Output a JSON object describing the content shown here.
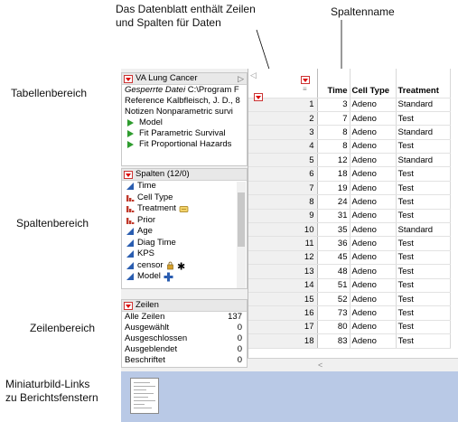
{
  "callouts": {
    "table_area": "Tabellenbereich",
    "column_area": "Spaltenbereich",
    "row_area": "Zeilenbereich",
    "thumbnail_line1": "Miniaturbild-Links",
    "thumbnail_line2": "zu Berichtsfenstern",
    "top_left_line1": "Das Datenblatt enthält Zeilen",
    "top_left_line2": "und Spalten für Daten",
    "column_name": "Spaltenname"
  },
  "table_panel": {
    "title": "VA Lung Cancer",
    "locked_file_label": "Gesperrte Datei",
    "locked_file_value": "C:\\Program F",
    "reference_label": "Reference",
    "reference_value": "Kalbfleisch, J. D., 8",
    "notes_label": "Notizen",
    "notes_value": "Nonparametric survi",
    "scripts": [
      "Model",
      "Fit Parametric Survival",
      "Fit Proportional Hazards"
    ]
  },
  "columns_panel": {
    "title": "Spalten (12/0)",
    "items": [
      {
        "name": "Time",
        "icon": "continuous-icon"
      },
      {
        "name": "Cell Type",
        "icon": "nominal-icon"
      },
      {
        "name": "Treatment",
        "icon": "nominal-icon",
        "extra": "value-labels-icon"
      },
      {
        "name": "Prior",
        "icon": "nominal-icon"
      },
      {
        "name": "Age",
        "icon": "continuous-icon"
      },
      {
        "name": "Diag Time",
        "icon": "continuous-icon"
      },
      {
        "name": "KPS",
        "icon": "continuous-icon"
      },
      {
        "name": "censor",
        "icon": "continuous-icon",
        "extra": "lock-and-asterisk-icon"
      },
      {
        "name": "Model",
        "icon": "continuous-icon",
        "extra": "formula-plus-icon"
      }
    ]
  },
  "rows_panel": {
    "title": "Zeilen",
    "items": [
      {
        "label": "Alle Zeilen",
        "value": "137"
      },
      {
        "label": "Ausgewählt",
        "value": "0"
      },
      {
        "label": "Ausgeschlossen",
        "value": "0"
      },
      {
        "label": "Ausgeblendet",
        "value": "0"
      },
      {
        "label": "Beschriftet",
        "value": "0"
      }
    ]
  },
  "grid": {
    "headers": [
      "Time",
      "Cell Type",
      "Treatment"
    ],
    "rows": [
      [
        "1",
        "3",
        "Adeno",
        "Standard"
      ],
      [
        "2",
        "7",
        "Adeno",
        "Test"
      ],
      [
        "3",
        "8",
        "Adeno",
        "Standard"
      ],
      [
        "4",
        "8",
        "Adeno",
        "Test"
      ],
      [
        "5",
        "12",
        "Adeno",
        "Standard"
      ],
      [
        "6",
        "18",
        "Adeno",
        "Test"
      ],
      [
        "7",
        "19",
        "Adeno",
        "Test"
      ],
      [
        "8",
        "24",
        "Adeno",
        "Test"
      ],
      [
        "9",
        "31",
        "Adeno",
        "Test"
      ],
      [
        "10",
        "35",
        "Adeno",
        "Standard"
      ],
      [
        "11",
        "36",
        "Adeno",
        "Test"
      ],
      [
        "12",
        "45",
        "Adeno",
        "Test"
      ],
      [
        "13",
        "48",
        "Adeno",
        "Test"
      ],
      [
        "14",
        "51",
        "Adeno",
        "Test"
      ],
      [
        "15",
        "52",
        "Adeno",
        "Test"
      ],
      [
        "16",
        "73",
        "Adeno",
        "Test"
      ],
      [
        "17",
        "80",
        "Adeno",
        "Test"
      ],
      [
        "18",
        "83",
        "Adeno",
        "Test"
      ]
    ]
  },
  "colors": {
    "accent_red": "#d00000",
    "script_green": "#2e9c2e",
    "continuous_blue": "#2a5db0",
    "nominal_red": "#c0392b",
    "thumbnail_strip": "#b9c9e6"
  }
}
